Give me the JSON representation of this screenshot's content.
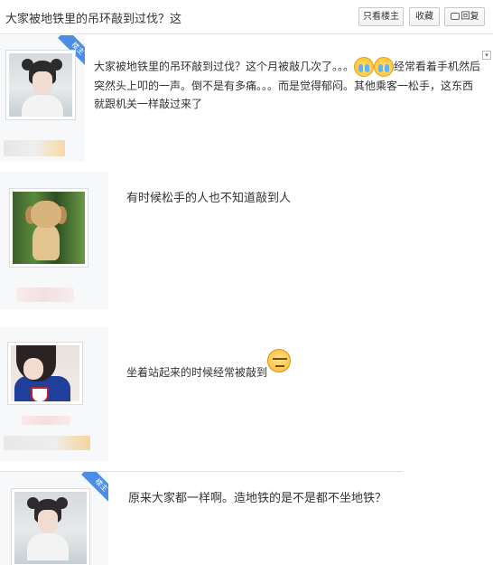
{
  "header": {
    "title": "大家被地铁里的吊环敲到过伐？这",
    "only_author_label": "只看楼主",
    "favorite_label": "收藏",
    "reply_label": "回复"
  },
  "posts": [
    {
      "is_op": true,
      "op_badge": "楼主",
      "text_part1": "大家被地铁里的吊环敲到过伐？这个月被敲几次了。。。",
      "text_part2": "经常看着手机然后突然头上叩的一声。倒不是有多痛。。。而是觉得郁闷。其他乘客一松手，这东西就跟机关一样敲过来了",
      "emojis": [
        "crying-face-icon",
        "crying-face-icon"
      ]
    },
    {
      "is_op": false,
      "text": "有时候松手的人也不知道敲到人"
    },
    {
      "is_op": false,
      "text": "坐着站起来的时候经常被敲到",
      "emojis": [
        "unamused-face-icon"
      ]
    },
    {
      "is_op": true,
      "op_badge": "楼主",
      "text": "原来大家都一样啊。造地铁的是不是都不坐地铁？"
    }
  ],
  "colors": {
    "sidebar_bg": "#f7f8fa",
    "op_badge": "#4a8ee8",
    "border": "#e4e4e4"
  }
}
